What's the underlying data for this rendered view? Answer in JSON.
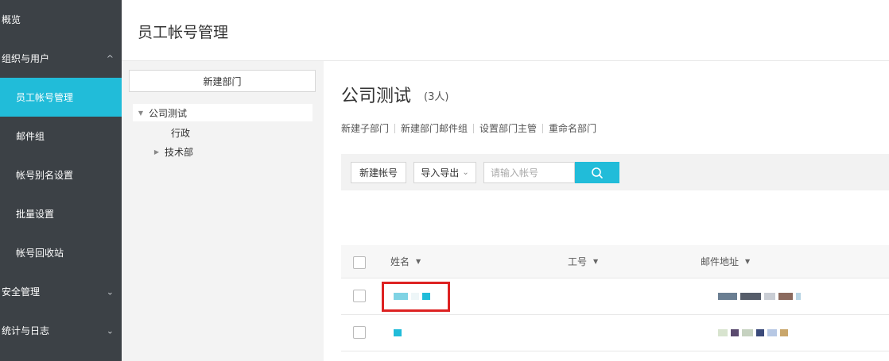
{
  "sidebar": {
    "items": [
      {
        "label": "概览"
      },
      {
        "label": "组织与用户"
      },
      {
        "label": "员工帐号管理"
      },
      {
        "label": "邮件组"
      },
      {
        "label": "帐号别名设置"
      },
      {
        "label": "批量设置"
      },
      {
        "label": "帐号回收站"
      },
      {
        "label": "安全管理"
      },
      {
        "label": "统计与日志"
      }
    ]
  },
  "header": {
    "title": "员工帐号管理"
  },
  "dept_panel": {
    "new_dept": "新建部门",
    "tree": {
      "root": "公司测试",
      "children": [
        "行政",
        "技术部"
      ]
    }
  },
  "main": {
    "dept_name": "公司测试",
    "count": "(3人)",
    "actions": [
      "新建子部门",
      "新建部门邮件组",
      "设置部门主管",
      "重命名部门"
    ],
    "toolbar": {
      "new_account": "新建帐号",
      "import_export": "导入导出",
      "search_placeholder": "请输入帐号"
    },
    "table": {
      "columns": [
        "姓名",
        "工号",
        "邮件地址"
      ]
    }
  },
  "colors": {
    "accent": "#21bcd9",
    "sidebar": "#3c4146",
    "highlight": "#dd2222"
  }
}
